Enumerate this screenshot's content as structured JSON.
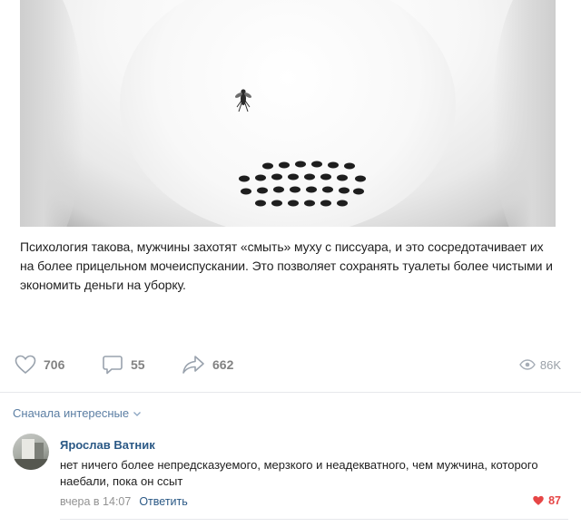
{
  "post": {
    "text": "Психология такова, мужчины захотят «смыть» муху с писсуара, и это сосредотачивает их на более прицельном мочеиспускании. Это позволяет сохранять туалеты более чистыми и экономить деньги на уборку.",
    "image": "urinal-with-fly-sticker"
  },
  "actions": {
    "likes": "706",
    "comments": "55",
    "shares": "662",
    "views": "86K"
  },
  "comments_sort": "Сначала интересные",
  "comment": {
    "author": "Ярослав Ватник",
    "text": "нет ничего более непредсказуемого, мерзкого и неадекватного, чем мужчина, которого наебали, пока он ссыт",
    "time": "вчера в 14:07",
    "reply_label": "Ответить",
    "likes": "87"
  },
  "colors": {
    "link": "#2a5885",
    "muted": "#828282",
    "like_active": "#e64646"
  }
}
